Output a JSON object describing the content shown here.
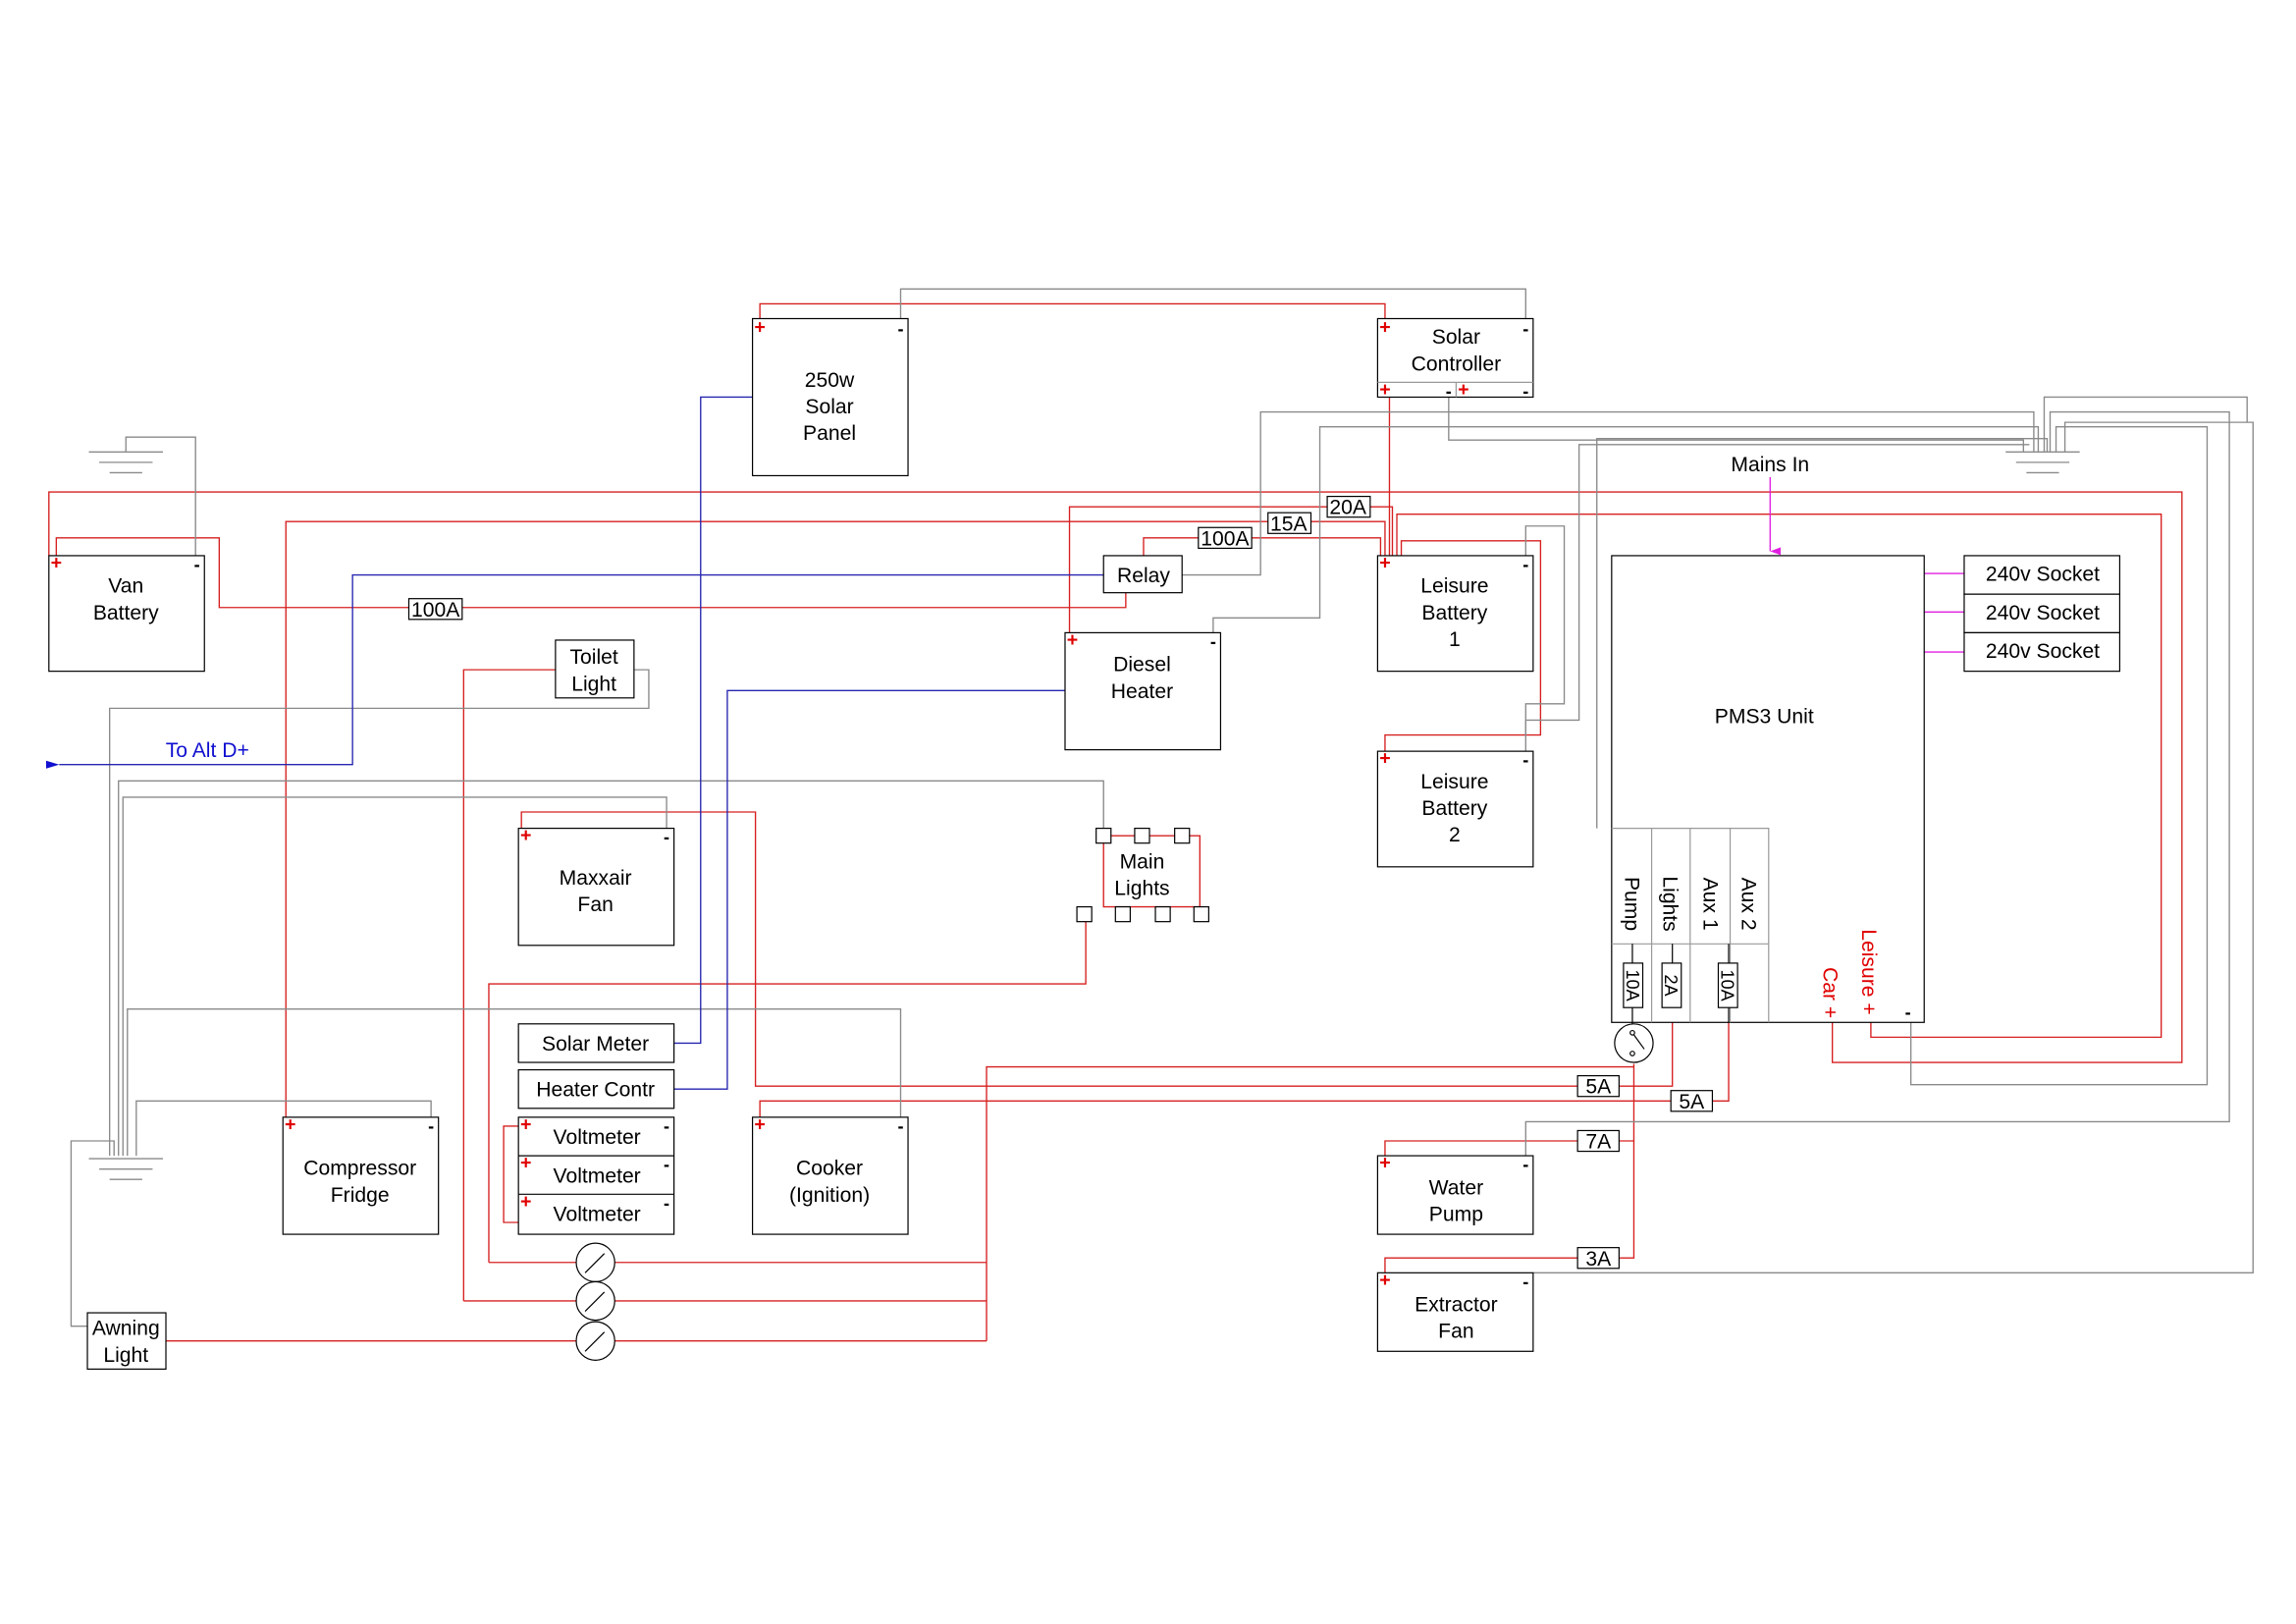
{
  "colors": {
    "positive": "#d62020",
    "ground": "#8a8a8a",
    "signal": "#2626b0",
    "mains": "#e020e0",
    "label_red": "#e00000",
    "label_blue": "#1010d0"
  },
  "components": {
    "solar_panel": [
      "250w",
      "Solar",
      "Panel"
    ],
    "solar_controller": [
      "Solar",
      "Controller"
    ],
    "van_battery": [
      "Van",
      "Battery"
    ],
    "relay": "Relay",
    "leisure_battery_1": [
      "Leisure",
      "Battery",
      "1"
    ],
    "leisure_battery_2": [
      "Leisure",
      "Battery",
      "2"
    ],
    "diesel_heater": [
      "Diesel",
      "Heater"
    ],
    "toilet_light": [
      "Toilet",
      "Light"
    ],
    "maxxair_fan": [
      "Maxxair",
      "Fan"
    ],
    "main_lights": [
      "Main",
      "Lights"
    ],
    "pms3": "PMS3 Unit",
    "pms_outputs": [
      "Pump",
      "Lights",
      "Aux 1",
      "Aux 2"
    ],
    "pms_fuses": [
      "10A",
      "2A",
      "10A"
    ],
    "pms_inputs": [
      "Leisure +",
      "Car +",
      "-"
    ],
    "sockets": [
      "240v Socket",
      "240v Socket",
      "240v Socket"
    ],
    "solar_meter": "Solar Meter",
    "heater_contr": "Heater Contr",
    "voltmeters": [
      "Voltmeter",
      "Voltmeter",
      "Voltmeter"
    ],
    "compressor_fridge": [
      "Compressor",
      "Fridge"
    ],
    "cooker": [
      "Cooker",
      "(Ignition)"
    ],
    "water_pump": [
      "Water",
      "Pump"
    ],
    "extractor_fan": [
      "Extractor",
      "Fan"
    ],
    "awning_light": [
      "Awning",
      "Light"
    ]
  },
  "fuses": {
    "van": "100A",
    "relay": "100A",
    "f15": "15A",
    "f20": "20A",
    "lights": "5A",
    "aux1": "5A",
    "pump": "7A",
    "extractor": "3A"
  },
  "labels": {
    "to_alt": "To Alt D+",
    "mains_in": "Mains In",
    "plus": "+",
    "minus": "-"
  }
}
